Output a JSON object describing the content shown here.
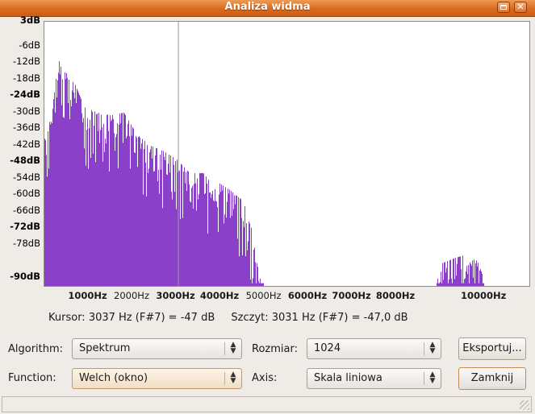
{
  "window": {
    "title": "Analiza widma",
    "buttons": [
      "maximize-icon",
      "close-icon"
    ]
  },
  "chart_data": {
    "type": "bar",
    "xlabel": "",
    "ylabel": "",
    "ylim": [
      -93,
      3
    ],
    "xlim": [
      0,
      11025
    ],
    "bar_color": "#8a40c8",
    "cursor_hz": 3037,
    "y_ticks": [
      {
        "label": "3dB",
        "value": 3,
        "bold": true
      },
      {
        "label": "-6dB",
        "value": -6,
        "bold": false
      },
      {
        "label": "-12dB",
        "value": -12,
        "bold": false
      },
      {
        "label": "-18dB",
        "value": -18,
        "bold": false
      },
      {
        "label": "-24dB",
        "value": -24,
        "bold": true
      },
      {
        "label": "-30dB",
        "value": -30,
        "bold": false
      },
      {
        "label": "-36dB",
        "value": -36,
        "bold": false
      },
      {
        "label": "-42dB",
        "value": -42,
        "bold": false
      },
      {
        "label": "-48dB",
        "value": -48,
        "bold": true
      },
      {
        "label": "-54dB",
        "value": -54,
        "bold": false
      },
      {
        "label": "-60dB",
        "value": -60,
        "bold": false
      },
      {
        "label": "-66dB",
        "value": -66,
        "bold": false
      },
      {
        "label": "-72dB",
        "value": -72,
        "bold": true
      },
      {
        "label": "-78dB",
        "value": -78,
        "bold": false
      },
      {
        "label": "-90dB",
        "value": -90,
        "bold": true
      }
    ],
    "x_ticks": [
      {
        "label": "1000Hz",
        "value": 1000,
        "bold": true
      },
      {
        "label": "2000Hz",
        "value": 2000,
        "bold": false
      },
      {
        "label": "3000Hz",
        "value": 3000,
        "bold": true
      },
      {
        "label": "4000Hz",
        "value": 4000,
        "bold": true
      },
      {
        "label": "5000Hz",
        "value": 5000,
        "bold": false
      },
      {
        "label": "6000Hz",
        "value": 6000,
        "bold": true
      },
      {
        "label": "7000Hz",
        "value": 7000,
        "bold": true
      },
      {
        "label": "8000Hz",
        "value": 8000,
        "bold": true
      },
      {
        "label": "10000Hz",
        "value": 10000,
        "bold": true
      }
    ],
    "envelope": [
      [
        0,
        -35
      ],
      [
        150,
        -32
      ],
      [
        300,
        -12
      ],
      [
        400,
        -10
      ],
      [
        500,
        -16
      ],
      [
        700,
        -20
      ],
      [
        900,
        -28
      ],
      [
        1200,
        -30
      ],
      [
        1500,
        -31
      ],
      [
        1800,
        -30
      ],
      [
        2100,
        -38
      ],
      [
        2400,
        -42
      ],
      [
        2700,
        -44
      ],
      [
        3000,
        -47
      ],
      [
        3300,
        -52
      ],
      [
        3600,
        -52
      ],
      [
        3900,
        -55
      ],
      [
        4200,
        -58
      ],
      [
        4500,
        -62
      ],
      [
        4700,
        -70
      ],
      [
        4800,
        -83
      ],
      [
        4900,
        -90
      ],
      [
        5000,
        -93
      ],
      [
        8900,
        -93
      ],
      [
        9000,
        -85
      ],
      [
        9150,
        -84
      ],
      [
        9300,
        -83
      ],
      [
        9500,
        -82
      ],
      [
        9700,
        -83
      ],
      [
        9850,
        -84
      ],
      [
        9950,
        -89
      ],
      [
        10000,
        -93
      ],
      [
        11025,
        -93
      ]
    ]
  },
  "status": {
    "cursor_text": "Kursor: 3037 Hz (F#7) = -47 dB",
    "peak_text": "Szczyt: 3031 Hz (F#7) = -47,0 dB"
  },
  "controls": {
    "algorithm_label": "Algorithm:",
    "algorithm_value": "Spektrum",
    "size_label": "Rozmiar:",
    "size_value": "1024",
    "export_label": "Eksportuj...",
    "function_label": "Function:",
    "function_value": "Welch (okno)",
    "axis_label": "Axis:",
    "axis_value": "Skala liniowa",
    "close_label": "Zamknij"
  }
}
